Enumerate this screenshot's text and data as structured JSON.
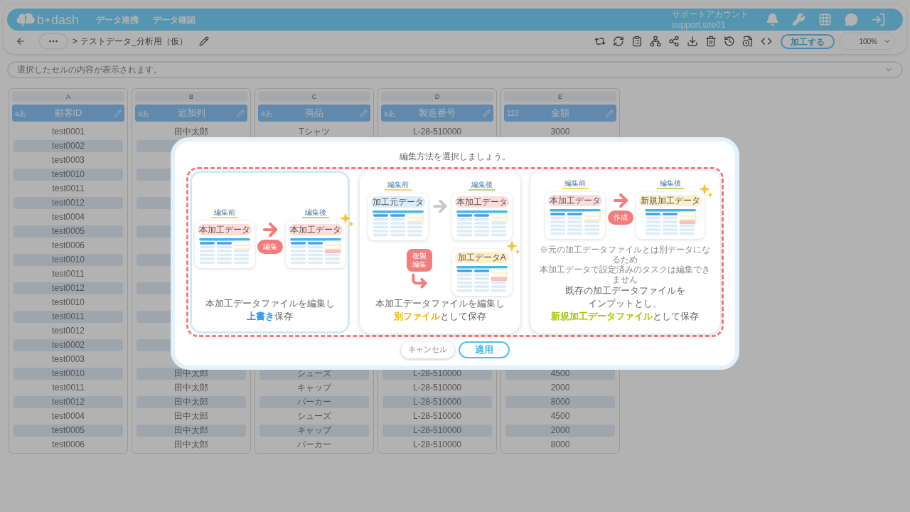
{
  "header": {
    "logo": {
      "left": "b",
      "right": "dash"
    },
    "nav": [
      "データ連携",
      "データ確認"
    ],
    "account": {
      "name": "サポートアカウント",
      "id": "support.site01"
    }
  },
  "toolbar": {
    "separator": ">",
    "breadcrumb": "テストデータ_分析用（仮）",
    "process_button": "加工する",
    "zoom": "100%"
  },
  "cell_info": {
    "placeholder": "選択したセルの内容が表示されます。"
  },
  "table": {
    "columns": [
      {
        "letter": "A",
        "type_label": "aあ",
        "title": "顧客ID",
        "cells": [
          "test0001",
          "test0002",
          "test0003",
          "test0010",
          "test0011",
          "test0012",
          "test0004",
          "test0005",
          "test0006",
          "test0010",
          "test0011",
          "test0012",
          "test0010",
          "test0011",
          "test0012",
          "test0002",
          "test0003",
          "test0010",
          "test0011",
          "test0012",
          "test0004",
          "test0005",
          "test0006"
        ]
      },
      {
        "letter": "B",
        "type_label": "aあ",
        "title": "追加列",
        "cells": [
          "田中太郎",
          null,
          null,
          null,
          null,
          null,
          null,
          null,
          null,
          null,
          null,
          null,
          null,
          null,
          null,
          null,
          null,
          "田中太郎",
          "田中太郎",
          "田中太郎",
          "田中太郎",
          "田中太郎",
          "田中太郎"
        ]
      },
      {
        "letter": "C",
        "type_label": "aあ",
        "title": "商品",
        "cells": [
          "Tシャツ",
          null,
          null,
          null,
          null,
          null,
          null,
          null,
          null,
          null,
          null,
          null,
          null,
          null,
          null,
          null,
          null,
          "シューズ",
          "キャップ",
          "パーカー",
          "シューズ",
          "キャップ",
          "パーカー"
        ]
      },
      {
        "letter": "D",
        "type_label": "aあ",
        "title": "製造番号",
        "cells": [
          "L-28-510000",
          null,
          null,
          null,
          null,
          null,
          null,
          null,
          null,
          null,
          null,
          null,
          null,
          null,
          null,
          null,
          null,
          "L-28-510000",
          "L-28-510000",
          "L-28-510000",
          "L-28-510000",
          "L-28-510000",
          "L-28-510000"
        ]
      },
      {
        "letter": "E",
        "type_label": "123",
        "title": "金額",
        "cells": [
          "3000",
          null,
          null,
          null,
          null,
          null,
          null,
          null,
          null,
          null,
          null,
          null,
          null,
          null,
          null,
          null,
          null,
          "4500",
          "2000",
          "8000",
          "4500",
          "2000",
          "8000"
        ]
      }
    ]
  },
  "dialog": {
    "title": "編集方法を選択しましょう。",
    "options": [
      {
        "kind": "overwrite",
        "selected": true,
        "before": {
          "label": "編集前",
          "tables": [
            {
              "title": "本加工データ",
              "color": "#fddcdc",
              "edited": false
            }
          ]
        },
        "action": [
          "編集"
        ],
        "after": {
          "label": "編集後",
          "tables": [
            {
              "title": "本加工データ",
              "color": "#fddcdc",
              "edited": true
            }
          ]
        },
        "caption": [
          [
            {
              "text": "本加工データファイルを編集し"
            }
          ],
          [
            {
              "text": "上書き",
              "color": "#2b95e9"
            },
            {
              "text": "保存"
            }
          ]
        ]
      },
      {
        "kind": "copy",
        "selected": false,
        "before": {
          "label": "編集前",
          "tables": [
            {
              "title": "加工元データ",
              "color": "#dcecf8",
              "edited": false
            }
          ]
        },
        "action": [
          "複製",
          "編集"
        ],
        "after": {
          "label": "編集後",
          "tables": [
            {
              "title": "本加工データ",
              "color": "#fddcdc",
              "edited": false
            },
            {
              "title": "加工データA",
              "color": "#fdf0c8",
              "edited": true
            }
          ]
        },
        "caption": [
          [
            {
              "text": "本加工データファイルを編集し"
            }
          ],
          [
            {
              "text": "別ファイル",
              "color": "#f5b400"
            },
            {
              "text": "として保存"
            }
          ]
        ]
      },
      {
        "kind": "new",
        "selected": false,
        "before": {
          "label": "編集前",
          "tables": [
            {
              "title": "本加工データ",
              "color": "#fddcdc",
              "edited": false
            }
          ]
        },
        "action": [
          "作成"
        ],
        "after": {
          "label": "編集後",
          "tables": [
            {
              "title": "新規加工データ",
              "color": "#fdf0c8",
              "edited": true
            }
          ]
        },
        "note": [
          "※元の加工データファイルとは別データになるため",
          "本加工データで設定済みのタスクは編集できません"
        ],
        "caption": [
          [
            {
              "text": "既存の加工データファイルを"
            }
          ],
          [
            {
              "text": "インプットとし、"
            }
          ],
          [
            {
              "text": "新規加工データファイル",
              "color": "#a8c800"
            },
            {
              "text": "として保存"
            }
          ]
        ]
      }
    ],
    "buttons": {
      "cancel": "キャンセル",
      "apply": "適用"
    }
  }
}
